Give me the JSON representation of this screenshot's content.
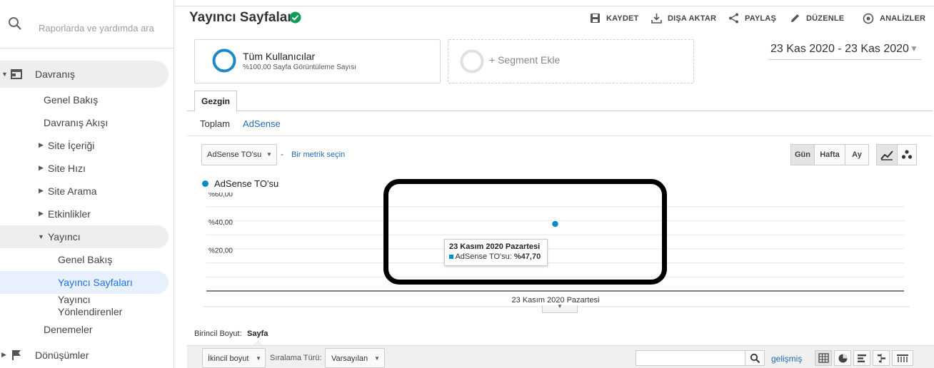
{
  "sidebar": {
    "search_placeholder": "Raporlarda ve yardımda ara",
    "items": [
      {
        "label": "Davranış"
      },
      {
        "label": "Genel Bakış"
      },
      {
        "label": "Davranış Akışı"
      },
      {
        "label": "Site İçeriği"
      },
      {
        "label": "Site Hızı"
      },
      {
        "label": "Site Arama"
      },
      {
        "label": "Etkinlikler"
      },
      {
        "label": "Yayıncı"
      },
      {
        "label": "Genel Bakış"
      },
      {
        "label": "Yayıncı Sayfaları"
      },
      {
        "label": "Yayıncı Yönlendirenler"
      },
      {
        "label": "Denemeler"
      },
      {
        "label": "Dönüşümler"
      }
    ]
  },
  "header": {
    "title": "Yayıncı Sayfaları",
    "tools": [
      "KAYDET",
      "DIŞA AKTAR",
      "PAYLAŞ",
      "DÜZENLE",
      "ANALİZLER"
    ]
  },
  "segments": {
    "active_name": "Tüm Kullanıcılar",
    "active_sub": "%100,00 Sayfa Görüntüleme Sayısı",
    "add_label": "+ Segment Ekle"
  },
  "date_range": "23 Kas 2020 - 23 Kas 2020",
  "explorer": {
    "tab": "Gezgin",
    "subtabs": [
      "Toplam",
      "AdSense"
    ],
    "metric_select": "AdSense TO'su",
    "dash": "-",
    "metric_link": "Bir metrik seçin",
    "period_buttons": [
      "Gün",
      "Hafta",
      "Ay"
    ]
  },
  "chart_data": {
    "type": "line",
    "legend": "AdSense TO'su",
    "x": [
      "23 Kasım 2020 Pazartesi"
    ],
    "values": [
      47.7
    ],
    "y_ticks": [
      "%60,00",
      "%40,00",
      "%20,00"
    ],
    "ylim": [
      0,
      70
    ],
    "series_color": "#058dc7",
    "grid": true,
    "tooltip_title": "23 Kasım 2020 Pazartesi",
    "tooltip_label": "AdSense TO'su:",
    "tooltip_value": "%47,70"
  },
  "table": {
    "primary_label": "Birincil Boyut:",
    "primary_value": "Sayfa",
    "secondary": "İkincil boyut",
    "sort_label": "Sıralama Türü:",
    "sort_value": "Varsayılan",
    "advanced": "gelişmiş"
  }
}
